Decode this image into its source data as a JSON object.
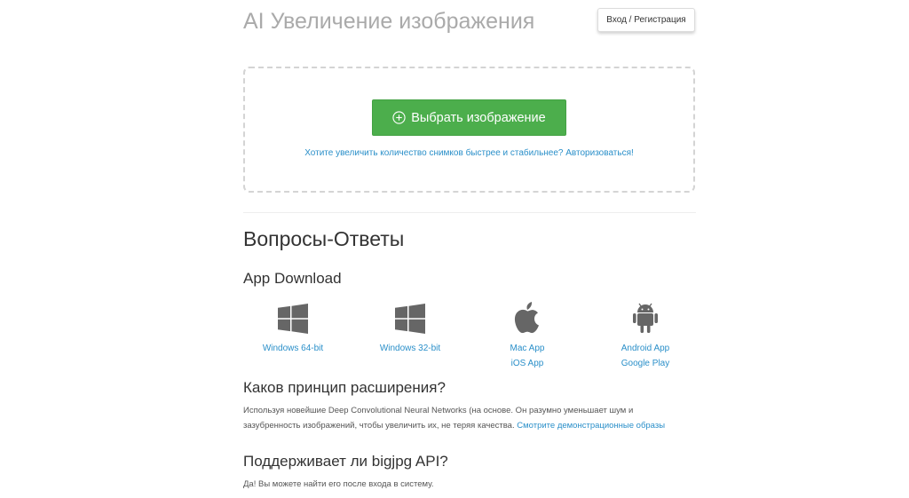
{
  "header": {
    "title": "AI Увеличение изображения",
    "login_label": "Вход / Регистрация"
  },
  "upload": {
    "select_label": "Выбрать изображение",
    "select_icon": "plus-circle-icon",
    "upgrade_link": "Хотите увеличить количество снимков быстрее и стабильнее? Авторизоваться!"
  },
  "faq": {
    "title": "Вопросы-Ответы",
    "app_download": {
      "title": "App Download",
      "apps": [
        {
          "icon": "windows-icon",
          "links": [
            "Windows 64-bit"
          ]
        },
        {
          "icon": "windows-icon",
          "links": [
            "Windows 32-bit"
          ]
        },
        {
          "icon": "apple-icon",
          "links": [
            "Mac App",
            "iOS App"
          ]
        },
        {
          "icon": "android-icon",
          "links": [
            "Android App",
            "Google Play"
          ]
        }
      ]
    },
    "q1": {
      "title": "Каков принцип расширения?",
      "text_line1": "Используя новейшие Deep Convolutional Neural Networks (на основе. Он разумно уменьшает шум и",
      "text_line2": "зазубренность изображений, чтобы увеличить их, не теряя качества.",
      "link": "Смотрите демонстрационные образы"
    },
    "q2": {
      "title": "Поддерживает ли bigjpg API?",
      "text": "Да! Вы можете найти его после входа в систему."
    }
  },
  "colors": {
    "accent_green": "#4cae4c",
    "link_blue": "#2a8fc9",
    "title_gray": "#aaaaaa",
    "icon_gray": "#666666"
  }
}
